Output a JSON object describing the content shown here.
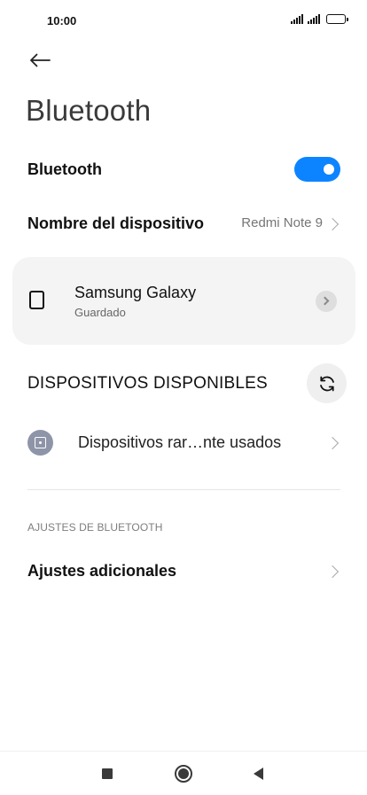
{
  "status_bar": {
    "time": "10:00",
    "icons": [
      "signal-icon",
      "signal-icon",
      "battery-icon"
    ]
  },
  "header": {
    "back_icon": "arrow-left-icon",
    "title": "Bluetooth"
  },
  "bluetooth_toggle": {
    "label": "Bluetooth",
    "enabled": true,
    "accent_color": "#0d84ff"
  },
  "device_name": {
    "label": "Nombre del dispositivo",
    "value": "Redmi Note 9"
  },
  "paired_device": {
    "icon": "phone-outline-icon",
    "name": "Samsung Galaxy",
    "status": "Guardado"
  },
  "available_devices": {
    "heading": "DISPOSITIVOS DISPONIBLES",
    "refresh_icon": "refresh-icon",
    "rare_devices_icon": "device-icon",
    "rare_devices_label": "Dispositivos rar…nte usados"
  },
  "bluetooth_settings": {
    "heading": "AJUSTES DE BLUETOOTH",
    "extra_label": "Ajustes adicionales"
  },
  "nav_bar": {
    "icons": [
      "recents-square-icon",
      "home-circle-icon",
      "back-triangle-icon"
    ]
  }
}
